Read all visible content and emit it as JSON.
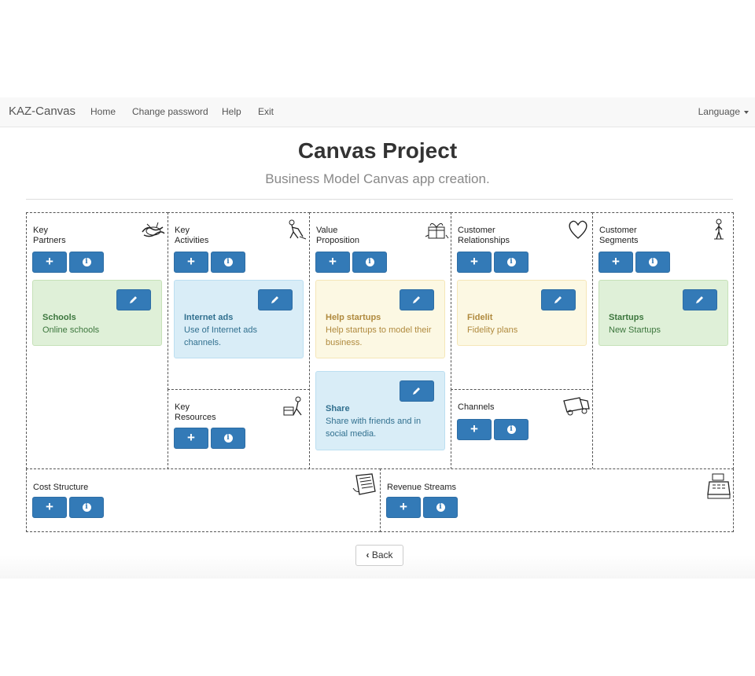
{
  "navbar": {
    "brand": "KAZ-Canvas",
    "links": [
      "Home",
      "Change password",
      "Help",
      "Exit"
    ],
    "language": "Language"
  },
  "header": {
    "title": "Canvas Project",
    "subtitle": "Business Model Canvas app creation."
  },
  "sections": {
    "key_partners": {
      "title": "Key\nPartners",
      "icon": "handshake-sketch-icon"
    },
    "key_activities": {
      "title": "Key\nActivities",
      "icon": "worker-sketch-icon"
    },
    "key_resources": {
      "title": "Key\nResources",
      "icon": "factory-worker-sketch-icon"
    },
    "value_proposition": {
      "title": "Value\nProposition",
      "icon": "gift-sketch-icon"
    },
    "customer_relationships": {
      "title": "Customer\nRelationships",
      "icon": "heart-sketch-icon"
    },
    "channels": {
      "title": "Channels",
      "icon": "truck-sketch-icon"
    },
    "customer_segments": {
      "title": "Customer\nSegments",
      "icon": "person-sketch-icon"
    },
    "cost_structure": {
      "title": "Cost Structure",
      "icon": "receipt-sketch-icon"
    },
    "revenue_streams": {
      "title": "Revenue Streams",
      "icon": "cash-register-sketch-icon"
    }
  },
  "notes": {
    "schools": {
      "title": "Schools",
      "text": "Online schools",
      "color": "#dff0d8"
    },
    "internet_ads": {
      "title": "Internet ads",
      "text": "Use of Internet ads channels.",
      "color": "#d9edf7"
    },
    "help_startups": {
      "title": "Help startups",
      "text": "Help startups to model their business.",
      "color": "#fcf8e3"
    },
    "share": {
      "title": "Share",
      "text": "Share with friends and in social media.",
      "color": "#d9edf7"
    },
    "fidelit": {
      "title": "Fidelit",
      "text": "Fidelity plans",
      "color": "#fcf8e3"
    },
    "startups": {
      "title": "Startups",
      "text": "New Startups",
      "color": "#dff0d8"
    }
  },
  "buttons": {
    "add": "+",
    "info": "i",
    "back": "Back"
  },
  "colors": {
    "primary": "#337ab7",
    "navbar_bg": "#f8f8f8"
  }
}
